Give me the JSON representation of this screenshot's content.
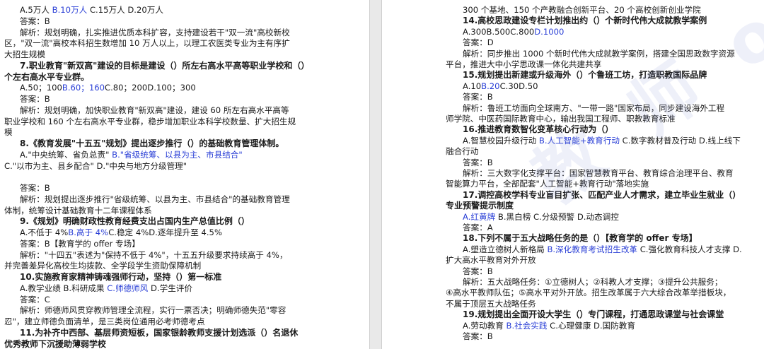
{
  "watermark": "教 师 offer 考 场",
  "left_page": {
    "lines": [
      {
        "kind": "opt",
        "segs": [
          {
            "t": "A.5万人 "
          },
          {
            "t": "B.10万人",
            "hl": true
          },
          {
            "t": " C.15万人 D.20万人"
          }
        ]
      },
      {
        "kind": "ans",
        "segs": [
          {
            "t": "答案：B"
          }
        ]
      },
      {
        "kind": "exp",
        "segs": [
          {
            "t": "解析：规划明确，扎实推进优质本科扩容，支持建设若干\"双一流\"高校新校"
          }
        ]
      },
      {
        "kind": "exp",
        "segs": [
          {
            "t": "区，\"双一流\"高校本科招生数增加 10 万人以上，以理工农医类专业为主有序扩"
          }
        ]
      },
      {
        "kind": "exp",
        "segs": [
          {
            "t": "大招生规模"
          }
        ]
      },
      {
        "kind": "q",
        "segs": [
          {
            "t": "7.职业教育\"新双高\"建设的目标是建设（）所左右高水平高等职业学校和（）"
          }
        ]
      },
      {
        "kind": "q",
        "segs": [
          {
            "t": "个左右高水平专业群。"
          }
        ]
      },
      {
        "kind": "opt",
        "segs": [
          {
            "t": "A.50；100"
          },
          {
            "t": "B.60；160",
            "hl": true
          },
          {
            "t": "C.80；200D.100；300"
          }
        ]
      },
      {
        "kind": "ans",
        "segs": [
          {
            "t": "答案：B"
          }
        ]
      },
      {
        "kind": "exp",
        "segs": [
          {
            "t": "解析：规划明确，加快职业教育\"新双高\"建设，建设 60 所左右高水平高等"
          }
        ]
      },
      {
        "kind": "exp",
        "segs": [
          {
            "t": "职业学校和 160 个左右高水平专业群，稳步增加职业本科学校数量、扩大招生规"
          }
        ]
      },
      {
        "kind": "exp",
        "segs": [
          {
            "t": "模"
          }
        ]
      },
      {
        "kind": "q",
        "segs": [
          {
            "t": "8.《教育发展\"十五五\"规划》提出逐步推行（）的基础教育管理体制。"
          }
        ]
      },
      {
        "kind": "opt",
        "segs": [
          {
            "t": "A.\"中央统筹、省负总责\" "
          },
          {
            "t": "B.\"省级统筹、以县为主、市县结合\"",
            "hl": true
          }
        ]
      },
      {
        "kind": "opt",
        "segs": [
          {
            "t": "C.\"以市为主、县乡配合\" D.\"中央与地方分级管理\""
          }
        ]
      },
      {
        "kind": "blank",
        "segs": [
          {
            "t": ""
          }
        ]
      },
      {
        "kind": "ans",
        "segs": [
          {
            "t": "答案：B"
          }
        ]
      },
      {
        "kind": "exp",
        "segs": [
          {
            "t": "解析：规划提出逐步推行\"省级统筹、以县为主、市县结合\"的基础教育管理"
          }
        ]
      },
      {
        "kind": "exp",
        "segs": [
          {
            "t": "体制，统筹设计基础教育十二年课程体系"
          }
        ]
      },
      {
        "kind": "q",
        "segs": [
          {
            "t": "9.《规划》明确财政性教育经费支出占国内生产总值比例（）"
          }
        ]
      },
      {
        "kind": "opt",
        "segs": [
          {
            "t": "A.不低于 4%"
          },
          {
            "t": "B.高于 4%",
            "hl": true
          },
          {
            "t": "C.稳定 4%D.逐年提升至 4.5%"
          }
        ]
      },
      {
        "kind": "ans",
        "segs": [
          {
            "t": "答案：B【教育学的 offer 专场】"
          }
        ]
      },
      {
        "kind": "exp",
        "segs": [
          {
            "t": "解析：\"十四五\"表述为\"保持不低于 4%\"，十五五升级要求持续高于 4%，"
          }
        ]
      },
      {
        "kind": "exp",
        "segs": [
          {
            "t": "并完善差异化高校生均拨款、全学段学生资助保障机制"
          }
        ]
      },
      {
        "kind": "q",
        "segs": [
          {
            "t": "10.实施教育家精神铸魂强师行动，坚持（）第一标准"
          }
        ]
      },
      {
        "kind": "opt",
        "segs": [
          {
            "t": "A.教学业绩 B.科研成果 "
          },
          {
            "t": "C.师德师风",
            "hl": true
          },
          {
            "t": " D.学生评价"
          }
        ]
      },
      {
        "kind": "ans",
        "segs": [
          {
            "t": "答案：C"
          }
        ]
      },
      {
        "kind": "exp",
        "segs": [
          {
            "t": "解析：师德师风贯穿教师管理全流程，实行一票否决；明确师德失范\"零容"
          }
        ]
      },
      {
        "kind": "exp",
        "segs": [
          {
            "t": "忍\"，建立师德负面清单，是三类岗位通用必考师德考点"
          }
        ]
      },
      {
        "kind": "q",
        "segs": [
          {
            "t": "11.为补齐中西部、基层师资短板，国家银龄教师支援计划选派（）名退休"
          }
        ]
      },
      {
        "kind": "q",
        "segs": [
          {
            "t": "优秀教师下沉援助薄弱学校"
          }
        ]
      }
    ]
  },
  "right_page": {
    "lines": [
      {
        "kind": "exp",
        "segs": [
          {
            "t": "300 个基地、150 个产教融合创新平台、20 个高校创新创业学院"
          }
        ]
      },
      {
        "kind": "q",
        "segs": [
          {
            "t": "14.高校思政建设专栏计划推出约（）个新时代伟大成就教学案例"
          }
        ]
      },
      {
        "kind": "opt",
        "segs": [
          {
            "t": "A.300B.500C.800"
          },
          {
            "t": "D.1000",
            "hl": true
          }
        ]
      },
      {
        "kind": "ans",
        "segs": [
          {
            "t": "答案：D"
          }
        ]
      },
      {
        "kind": "exp",
        "segs": [
          {
            "t": "解析：同步推出 1000 个新时代伟大成就教学案例，搭建全国思政数字资源"
          }
        ]
      },
      {
        "kind": "exp",
        "segs": [
          {
            "t": "平台，推进大中小学思政课一体化共建共享"
          }
        ]
      },
      {
        "kind": "q",
        "segs": [
          {
            "t": "15.规划提出新建或升级海外（）个鲁班工坊，打造职教国际品牌"
          }
        ]
      },
      {
        "kind": "opt",
        "segs": [
          {
            "t": "A.10"
          },
          {
            "t": "B.20",
            "hl": true
          },
          {
            "t": "C.30D.50"
          }
        ]
      },
      {
        "kind": "ans",
        "segs": [
          {
            "t": "答案：B"
          }
        ]
      },
      {
        "kind": "exp",
        "segs": [
          {
            "t": "解析：鲁班工坊面向全球南方、\"一带一路\"国家布局，同步建设海外工程"
          }
        ]
      },
      {
        "kind": "exp",
        "segs": [
          {
            "t": "师学院、中医药国际教育中心，输出我国工程师、职教教育标准"
          }
        ]
      },
      {
        "kind": "q",
        "segs": [
          {
            "t": "16.推进教育数智化变革核心行动为（）"
          }
        ]
      },
      {
        "kind": "opt",
        "segs": [
          {
            "t": "A.智慧校园升级行动 "
          },
          {
            "t": "B.人工智能+教育行动",
            "hl": true
          },
          {
            "t": " C.数字教材普及行动 D.线上线下"
          }
        ]
      },
      {
        "kind": "opt",
        "segs": [
          {
            "t": "融合行动"
          }
        ]
      },
      {
        "kind": "ans",
        "segs": [
          {
            "t": "答案：B"
          }
        ]
      },
      {
        "kind": "exp",
        "segs": [
          {
            "t": "解析：三大数字化支撑平台：国家智慧教育平台、教育综合治理平台、教育"
          }
        ]
      },
      {
        "kind": "exp",
        "segs": [
          {
            "t": "智能算力平台，全部配套\"人工智能+教育行动\"落地实施"
          }
        ]
      },
      {
        "kind": "q",
        "segs": [
          {
            "t": "17.调控高校学科专业盲目扩张、匹配产业人才需求，建立毕业生就业（）"
          }
        ]
      },
      {
        "kind": "q",
        "segs": [
          {
            "t": "专业预警提示制度"
          }
        ]
      },
      {
        "kind": "opt",
        "segs": [
          {
            "t": "A.红黄牌",
            "hl": true
          },
          {
            "t": " B.黑白榜 C.分级预警 D.动态调控"
          }
        ]
      },
      {
        "kind": "ans",
        "segs": [
          {
            "t": "答案：A"
          }
        ]
      },
      {
        "kind": "q",
        "segs": [
          {
            "t": "18.下列不属于五大战略任务的是（）【教育学的 offer 专场】"
          }
        ]
      },
      {
        "kind": "opt",
        "segs": [
          {
            "t": "A.塑造立德树人新格局 "
          },
          {
            "t": "B.深化教育考试招生改革",
            "hl": true
          },
          {
            "t": " C.强化教育科技人才支撑 D."
          }
        ]
      },
      {
        "kind": "opt",
        "segs": [
          {
            "t": "扩大高水平教育对外开放"
          }
        ]
      },
      {
        "kind": "ans",
        "segs": [
          {
            "t": "答案：B"
          }
        ]
      },
      {
        "kind": "exp",
        "segs": [
          {
            "t": "解析：五大战略任务：①立德树人；②科教人才支撑；③提升公共服务；"
          }
        ]
      },
      {
        "kind": "exp",
        "segs": [
          {
            "t": "④高水平教师队伍；⑤高水平对外开放。招生改革属于六大综合改革举措板块，"
          }
        ]
      },
      {
        "kind": "exp",
        "segs": [
          {
            "t": "不属于顶层五大战略任务"
          }
        ]
      },
      {
        "kind": "q",
        "segs": [
          {
            "t": "19.规划提出全面开设大学生（）专门课程，打通思政课堂与社会课堂"
          }
        ]
      },
      {
        "kind": "opt",
        "segs": [
          {
            "t": "A.劳动教育 "
          },
          {
            "t": "B.社会实践",
            "hl": true
          },
          {
            "t": " C.心理健康 D.国防教育"
          }
        ]
      },
      {
        "kind": "ans",
        "segs": [
          {
            "t": "答案：B"
          }
        ]
      }
    ]
  }
}
